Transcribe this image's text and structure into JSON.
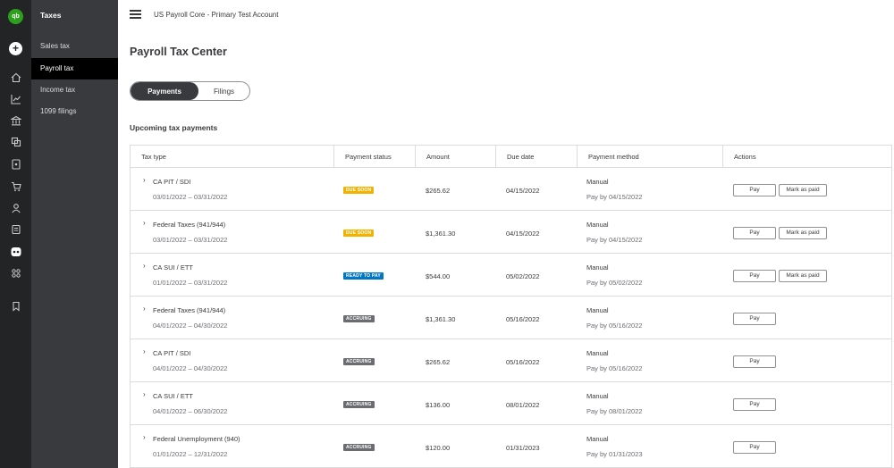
{
  "rail": {
    "logo": "qb",
    "plus": "+",
    "icons": [
      "home-icon",
      "chart-icon",
      "bank-icon",
      "documents-icon",
      "calculator-icon",
      "cart-icon",
      "people-icon",
      "taxes-icon",
      "apps-icon",
      "bookmark-icon"
    ]
  },
  "subnav": {
    "title": "Taxes",
    "items": [
      {
        "label": "Sales tax"
      },
      {
        "label": "Payroll tax"
      },
      {
        "label": "Income tax"
      },
      {
        "label": "1099 filings"
      }
    ]
  },
  "header": {
    "account": "US Payroll Core - Primary Test Account"
  },
  "page": {
    "title": "Payroll Tax Center",
    "tabs": [
      "Payments",
      "Filings"
    ],
    "section_title": "Upcoming tax payments"
  },
  "table": {
    "headers": [
      "Tax type",
      "Payment status",
      "Amount",
      "Due date",
      "Payment method",
      "Actions"
    ],
    "pay_label": "Pay",
    "mark_label": "Mark as paid",
    "rows": [
      {
        "tax_type": "CA PIT / SDI",
        "period": "03/01/2022 – 03/31/2022",
        "status": "DUE SOON",
        "amount": "$265.62",
        "due": "04/15/2022",
        "method": "Manual",
        "pay_by": "Pay by 04/15/2022"
      },
      {
        "tax_type": "Federal Taxes (941/944)",
        "period": "03/01/2022 – 03/31/2022",
        "status": "DUE SOON",
        "amount": "$1,361.30",
        "due": "04/15/2022",
        "method": "Manual",
        "pay_by": "Pay by 04/15/2022"
      },
      {
        "tax_type": "CA SUI / ETT",
        "period": "01/01/2022 – 03/31/2022",
        "status": "READY TO PAY",
        "amount": "$544.00",
        "due": "05/02/2022",
        "method": "Manual",
        "pay_by": "Pay by 05/02/2022"
      },
      {
        "tax_type": "Federal Taxes (941/944)",
        "period": "04/01/2022 – 04/30/2022",
        "status": "ACCRUING",
        "amount": "$1,361.30",
        "due": "05/16/2022",
        "method": "Manual",
        "pay_by": "Pay by 05/16/2022"
      },
      {
        "tax_type": "CA PIT / SDI",
        "period": "04/01/2022 – 04/30/2022",
        "status": "ACCRUING",
        "amount": "$265.62",
        "due": "05/16/2022",
        "method": "Manual",
        "pay_by": "Pay by 05/16/2022"
      },
      {
        "tax_type": "CA SUI / ETT",
        "period": "04/01/2022 – 06/30/2022",
        "status": "ACCRUING",
        "amount": "$136.00",
        "due": "08/01/2022",
        "method": "Manual",
        "pay_by": "Pay by 08/01/2022"
      },
      {
        "tax_type": "Federal Unemployment (940)",
        "period": "01/01/2022 – 12/31/2022",
        "status": "ACCRUING",
        "amount": "$120.00",
        "due": "01/31/2023",
        "method": "Manual",
        "pay_by": "Pay by 01/31/2023"
      }
    ]
  },
  "colors": {
    "due_soon": "#f0b400",
    "ready_to_pay": "#0077c5",
    "accruing": "#6b6c72",
    "sidebar": "#393a3d",
    "rail": "#232426",
    "brand": "#2ca01c"
  }
}
